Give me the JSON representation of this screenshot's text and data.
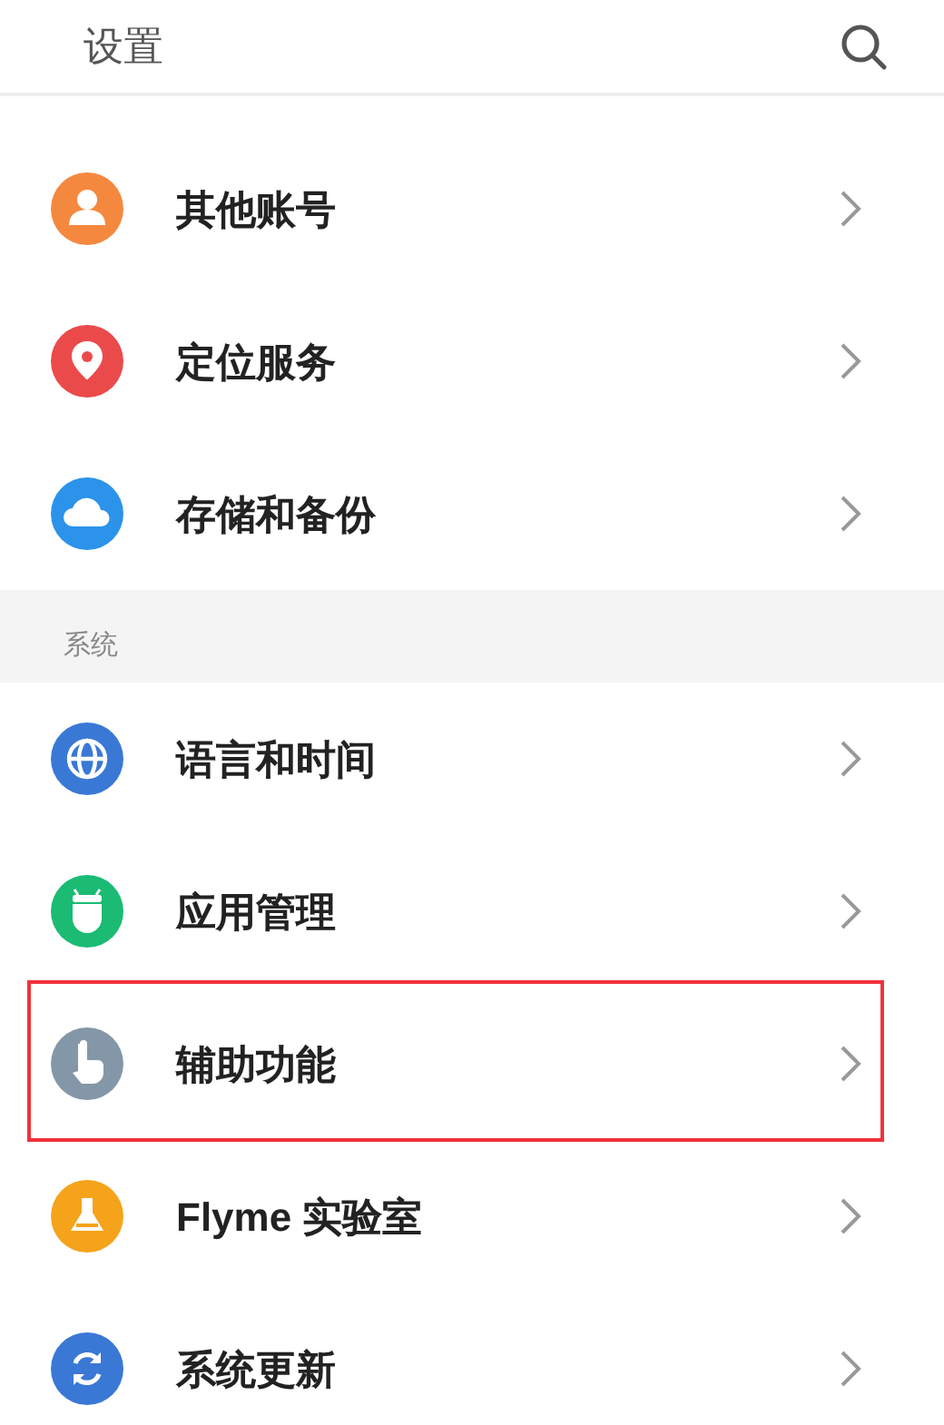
{
  "header": {
    "title": "设置"
  },
  "sections": [
    {
      "items": [
        {
          "label": "其他账号",
          "kind": "person",
          "color": "#f5883f",
          "highlighted": false
        },
        {
          "label": "定位服务",
          "kind": "pin",
          "color": "#eb4a4a",
          "highlighted": false
        },
        {
          "label": "存储和备份",
          "kind": "cloud",
          "color": "#2b93ea",
          "highlighted": false
        }
      ]
    },
    {
      "title": "系统",
      "items": [
        {
          "label": "语言和时间",
          "kind": "globe",
          "color": "#3a78d6",
          "highlighted": false
        },
        {
          "label": "应用管理",
          "kind": "android",
          "color": "#1bbb73",
          "highlighted": false
        },
        {
          "label": "辅助功能",
          "kind": "hand",
          "color": "#8497a8",
          "highlighted": true
        },
        {
          "label": "Flyme 实验室",
          "kind": "flask",
          "color": "#f5a31a",
          "highlighted": false
        },
        {
          "label": "系统更新",
          "kind": "refresh",
          "color": "#3a78d6",
          "highlighted": false
        }
      ]
    }
  ]
}
